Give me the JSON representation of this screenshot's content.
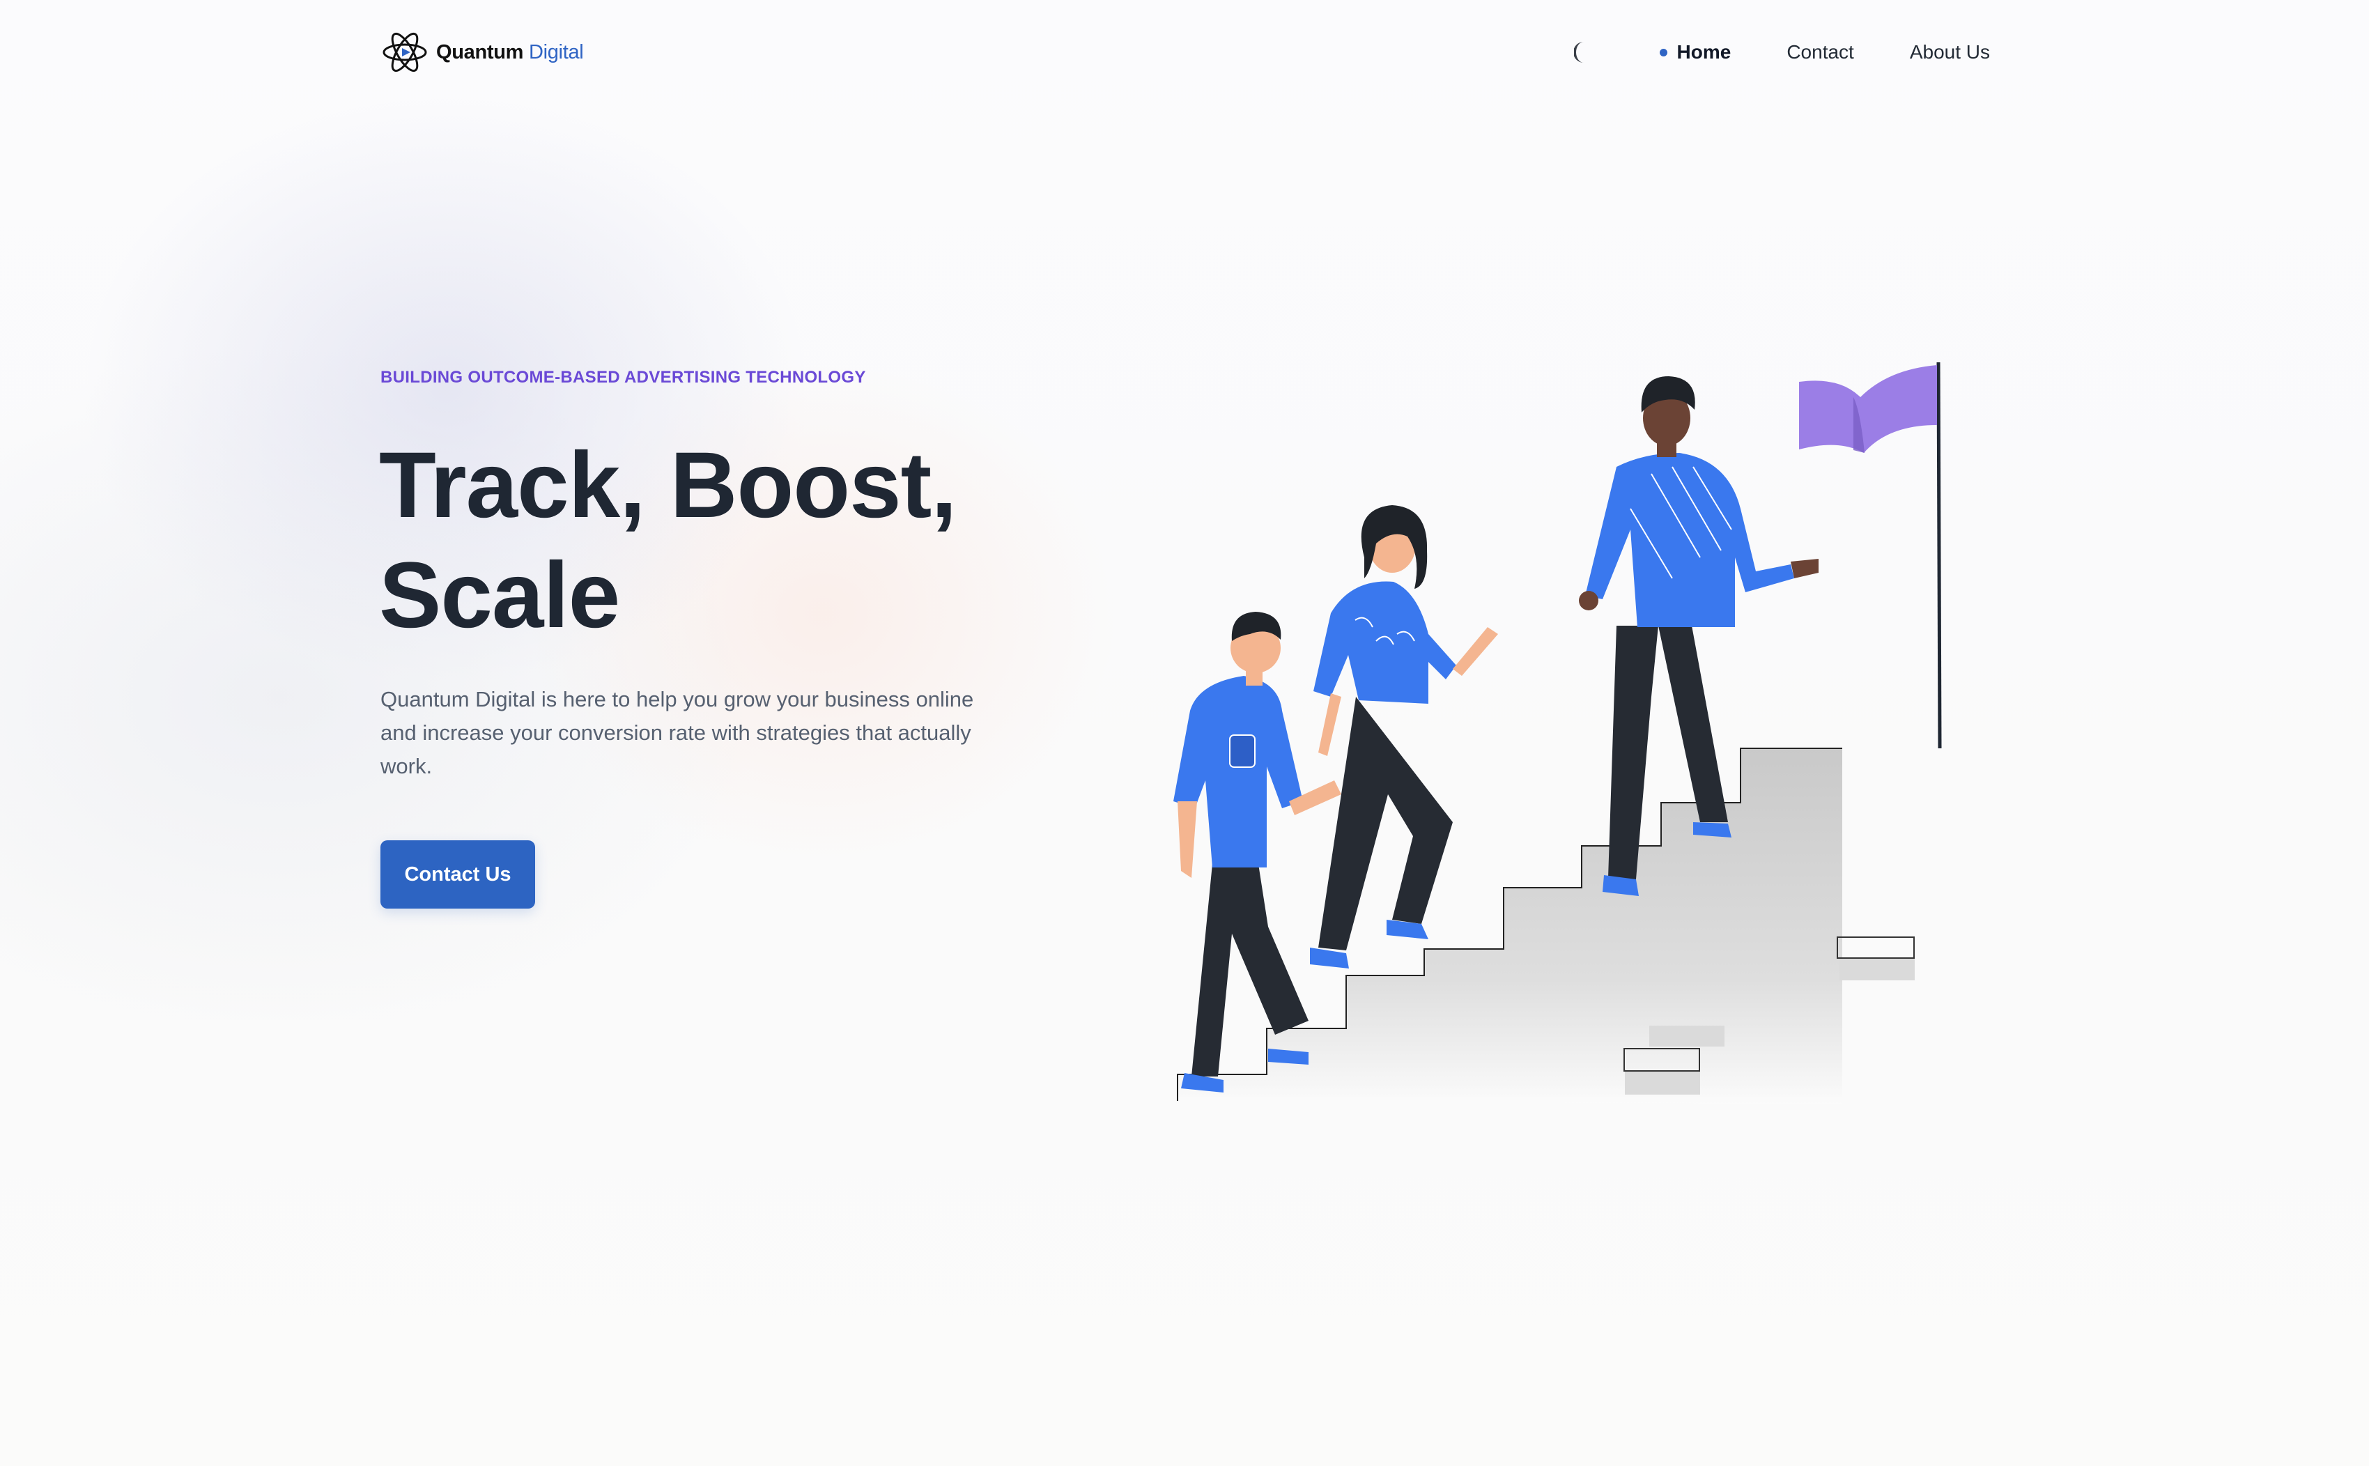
{
  "brand": {
    "name_primary": "Quantum",
    "name_accent": "Digital",
    "accent_color": "#2f64c4"
  },
  "nav": {
    "theme_toggle_icon": "moon-icon",
    "items": [
      {
        "label": "Home",
        "active": true
      },
      {
        "label": "Contact",
        "active": false
      },
      {
        "label": "About Us",
        "active": false
      }
    ]
  },
  "hero": {
    "eyebrow": "BUILDING OUTCOME-BASED ADVERTISING TECHNOLOGY",
    "headline_line1": "Track, Boost,",
    "headline_line2": "Scale",
    "description": "Quantum Digital is here to help you grow your business online and increase your conversion rate with strategies that actually work.",
    "cta_label": "Contact Us",
    "cta_color": "#2d64c2",
    "eyebrow_color": "#6a49d6"
  },
  "illustration": {
    "icon": "team-climbing-stairs-illustration",
    "flag_color": "#9b7ee6",
    "shirt_color": "#3a78ee"
  }
}
